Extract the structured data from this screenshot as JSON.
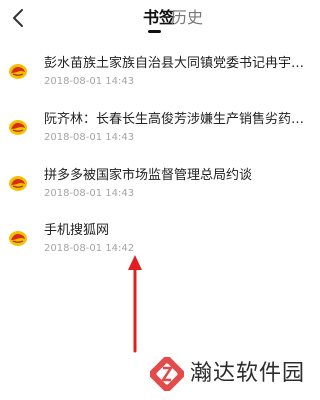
{
  "header": {
    "tabs": [
      {
        "label": "书签",
        "active": true
      },
      {
        "label": "历史",
        "active": false
      }
    ]
  },
  "bookmarks": [
    {
      "title": "彭水苗族土家族自治县大同镇党委书记冉宇航涉嫌严重违纪",
      "time": "2018-08-01 14:43",
      "icon": "sohu-fox-icon"
    },
    {
      "title": "阮齐林：长春长生高俊芳涉嫌生产销售劣药罪并不是最终定性",
      "time": "2018-08-01 14:43",
      "icon": "sohu-fox-icon"
    },
    {
      "title": "拼多多被国家市场监督管理总局约谈",
      "time": "2018-08-01 14:43",
      "icon": "sohu-fox-icon"
    },
    {
      "title": "手机搜狐网",
      "time": "2018-08-01 14:42",
      "icon": "sohu-fox-icon"
    }
  ],
  "watermark": {
    "text": "瀚达软件园"
  },
  "colors": {
    "arrow": "#e02020",
    "icon_primary": "#f2c100",
    "icon_secondary": "#d92a1c",
    "watermark_logo": "#e34b4b"
  }
}
